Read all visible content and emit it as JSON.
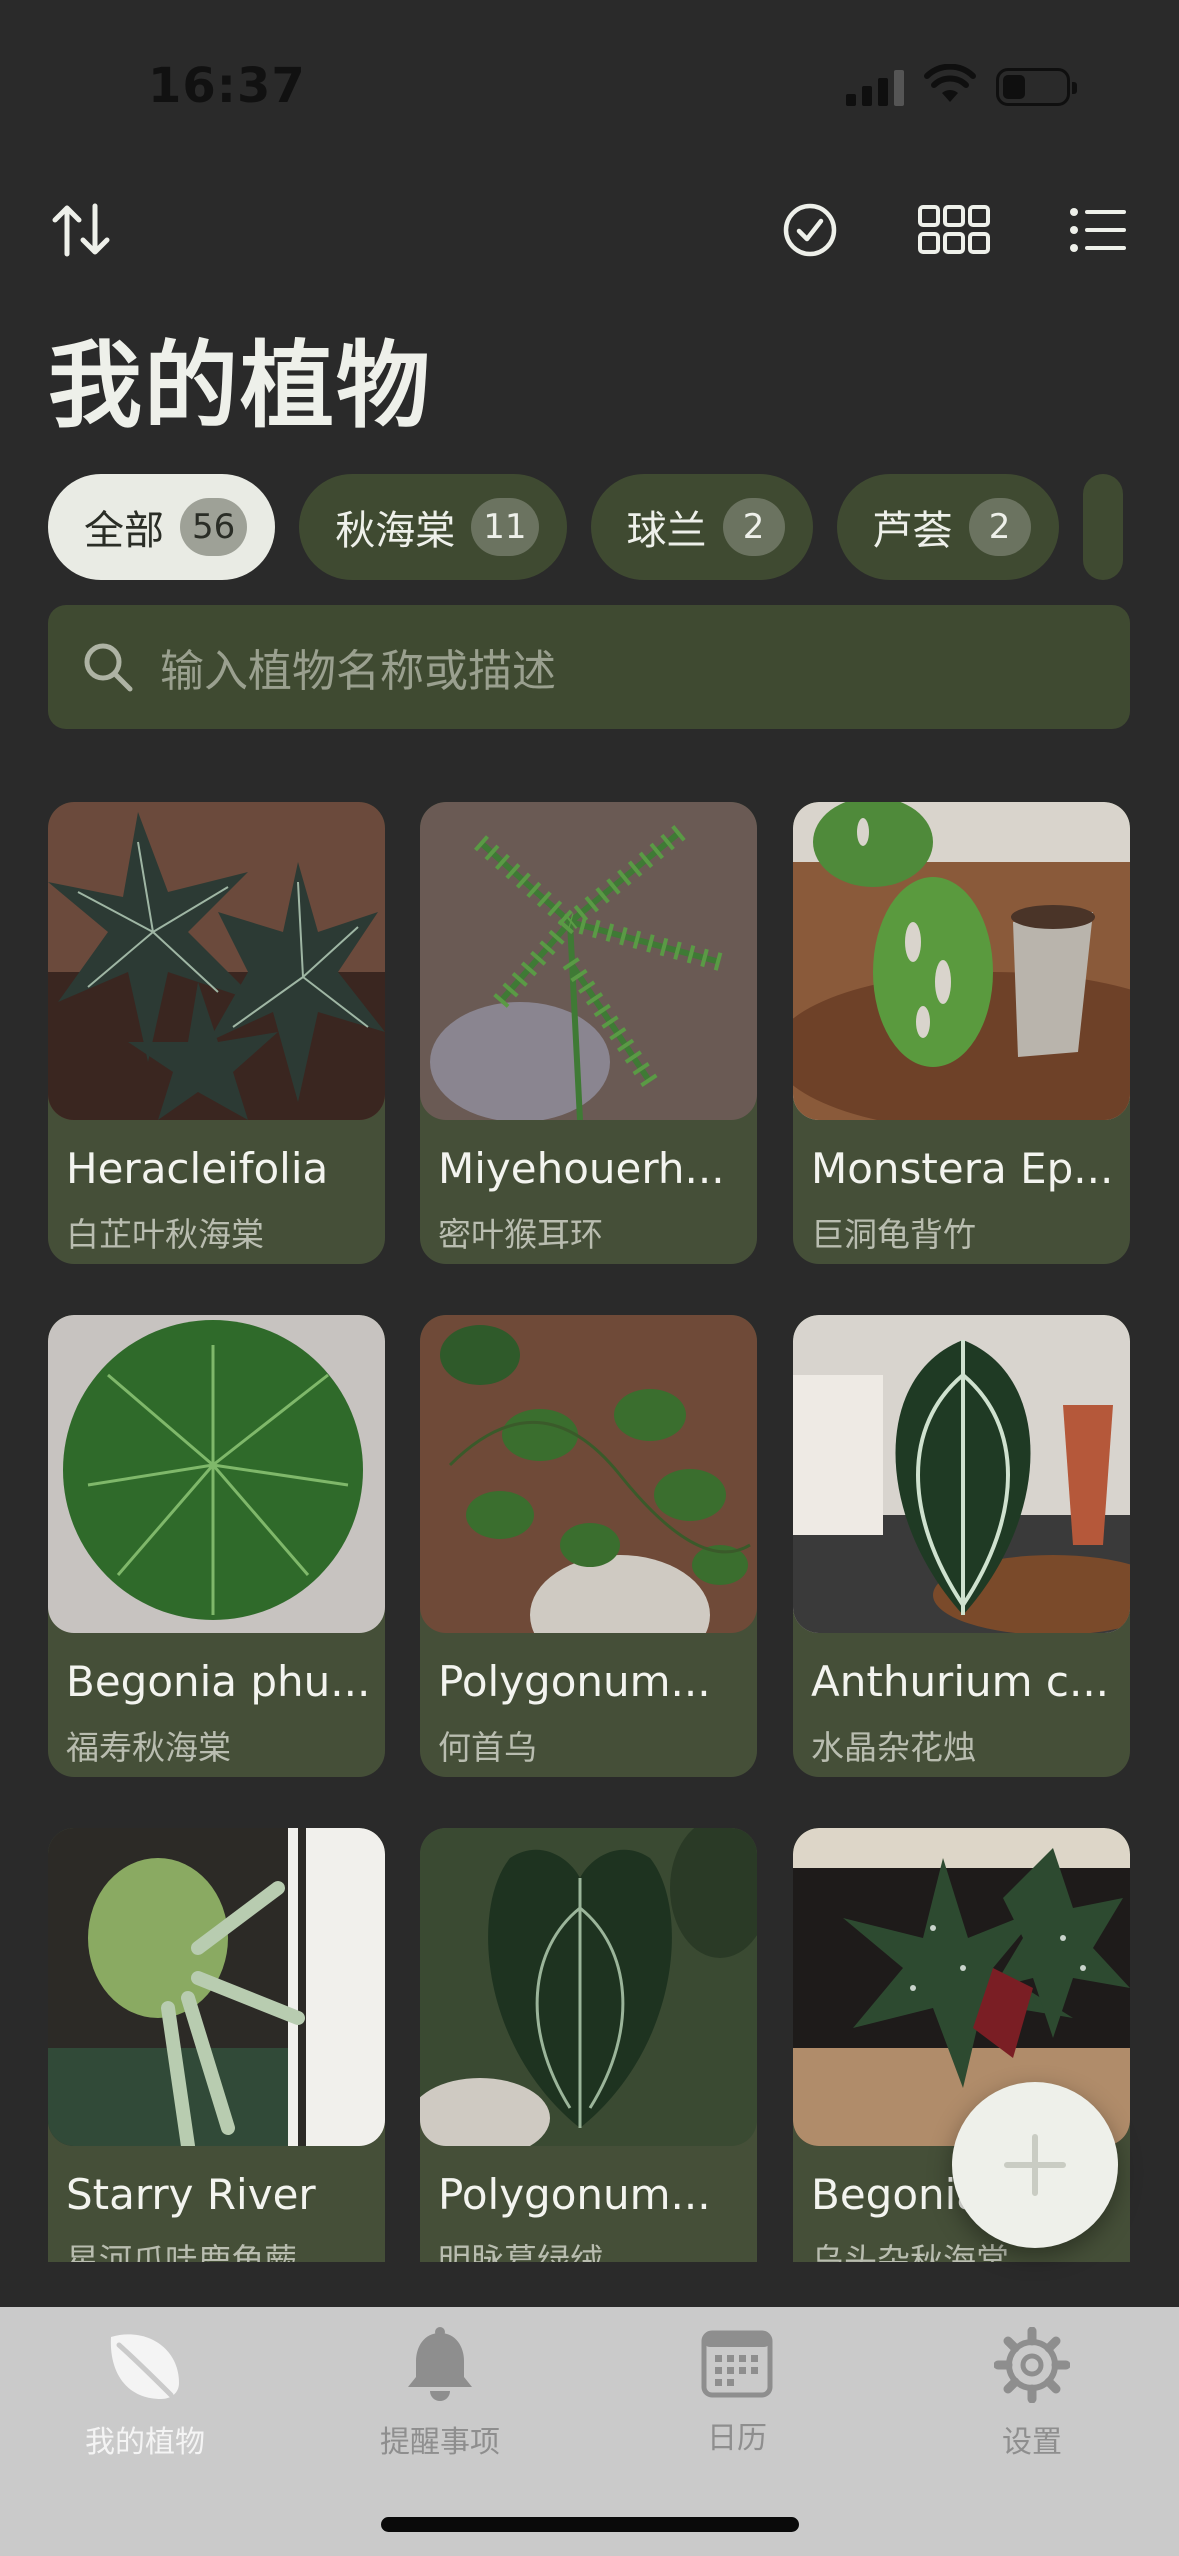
{
  "status_bar": {
    "time": "16:37"
  },
  "toolbar": {
    "sort_icon": "sort-arrows-icon",
    "select_icon": "checkmark-circle-icon",
    "grid_icon": "grid-view-icon",
    "list_icon": "list-view-icon"
  },
  "page_title": "我的植物",
  "filters": [
    {
      "label": "全部",
      "count": "56",
      "active": true
    },
    {
      "label": "秋海棠",
      "count": "11"
    },
    {
      "label": "球兰",
      "count": "2"
    },
    {
      "label": "芦荟",
      "count": "2"
    }
  ],
  "search": {
    "placeholder": "输入植物名称或描述"
  },
  "plants": [
    {
      "name": "Heracleifolia",
      "sub": "白芷叶秋海棠"
    },
    {
      "name": "Miyehouerh...",
      "sub": "密叶猴耳环"
    },
    {
      "name": "Monstera Ep...",
      "sub": "巨洞龟背竹"
    },
    {
      "name": "Begonia phu...",
      "sub": "福寿秋海棠"
    },
    {
      "name": "Polygonum...",
      "sub": "何首乌"
    },
    {
      "name": "Anthurium c...",
      "sub": "水晶杂花烛"
    },
    {
      "name": "Starry River",
      "sub": "星河爪哇鹿角蕨"
    },
    {
      "name": "Polygonum...",
      "sub": "明脉葛绿绒"
    },
    {
      "name": "Begonia",
      "sub": "乌头杂秋海棠"
    }
  ],
  "tabs": [
    {
      "label": "我的植物",
      "icon": "leaf-icon",
      "active": true
    },
    {
      "label": "提醒事项",
      "icon": "bell-icon"
    },
    {
      "label": "日历",
      "icon": "calendar-icon"
    },
    {
      "label": "设置",
      "icon": "gear-icon"
    }
  ],
  "colors": {
    "background": "#2a2a2a",
    "card": "#454f38",
    "chip": "#3f4a31",
    "tab_bar": "#cacaca"
  }
}
